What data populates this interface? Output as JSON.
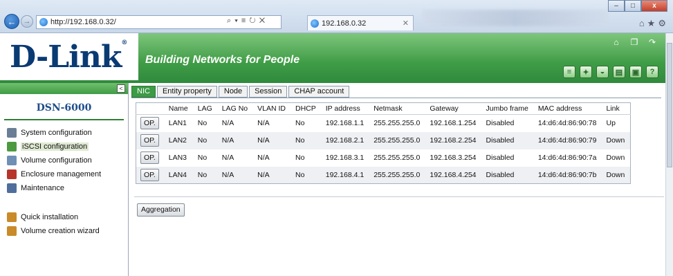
{
  "browser": {
    "url": "http://192.168.0.32/",
    "address_tools": "⌕ ▾ ≡ ↻ ✕",
    "tab_title": "192.168.0.32",
    "tab_close": "✕",
    "back_glyph": "←",
    "forward_glyph": "→",
    "minimize": "–",
    "maximize": "□",
    "close": "x",
    "fav_icons": "⌂★⚙"
  },
  "header": {
    "logo": "D-Link",
    "logo_reg": "®",
    "tagline": "Building Networks for People",
    "top_icons": [
      {
        "name": "home-icon",
        "glyph": "⌂"
      },
      {
        "name": "reboot-icon",
        "glyph": "❐"
      },
      {
        "name": "logout-icon",
        "glyph": "↷"
      }
    ],
    "tool_icons": [
      {
        "name": "disk-icon",
        "glyph": "≡"
      },
      {
        "name": "wizard-icon",
        "glyph": "✦"
      },
      {
        "name": "network-icon",
        "glyph": "◒"
      },
      {
        "name": "save-icon",
        "glyph": "▤"
      },
      {
        "name": "monitor-icon",
        "glyph": "▣"
      },
      {
        "name": "help-icon",
        "glyph": "?"
      }
    ]
  },
  "sidebar": {
    "collapse_glyph": "<",
    "device_name": "DSN-6000",
    "menu": [
      {
        "label": "System configuration",
        "icon": "system-config-icon",
        "color": "#6a7f95"
      },
      {
        "label": "iSCSI configuration",
        "icon": "iscsi-config-icon",
        "color": "#4c9a3f",
        "selected": true
      },
      {
        "label": "Volume configuration",
        "icon": "volume-config-icon",
        "color": "#6f8fb5"
      },
      {
        "label": "Enclosure management",
        "icon": "enclosure-icon",
        "color": "#b8342a"
      },
      {
        "label": "Maintenance",
        "icon": "maintenance-icon",
        "color": "#4f6e9c"
      }
    ],
    "menu2": [
      {
        "label": "Quick installation",
        "icon": "quick-install-icon",
        "color": "#c98a2a"
      },
      {
        "label": "Volume creation wizard",
        "icon": "volume-wizard-icon",
        "color": "#c98a2a"
      }
    ]
  },
  "tabs": [
    {
      "label": "NIC",
      "active": true
    },
    {
      "label": "Entity property"
    },
    {
      "label": "Node"
    },
    {
      "label": "Session"
    },
    {
      "label": "CHAP account"
    }
  ],
  "nic_table": {
    "headers": [
      "",
      "Name",
      "LAG",
      "LAG No",
      "VLAN ID",
      "DHCP",
      "IP address",
      "Netmask",
      "Gateway",
      "Jumbo frame",
      "MAC address",
      "Link"
    ],
    "rows": [
      [
        "OP.",
        "LAN1",
        "No",
        "N/A",
        "N/A",
        "No",
        "192.168.1.1",
        "255.255.255.0",
        "192.168.1.254",
        "Disabled",
        "14:d6:4d:86:90:78",
        "Up"
      ],
      [
        "OP.",
        "LAN2",
        "No",
        "N/A",
        "N/A",
        "No",
        "192.168.2.1",
        "255.255.255.0",
        "192.168.2.254",
        "Disabled",
        "14:d6:4d:86:90:79",
        "Down"
      ],
      [
        "OP.",
        "LAN3",
        "No",
        "N/A",
        "N/A",
        "No",
        "192.168.3.1",
        "255.255.255.0",
        "192.168.3.254",
        "Disabled",
        "14:d6:4d:86:90:7a",
        "Down"
      ],
      [
        "OP.",
        "LAN4",
        "No",
        "N/A",
        "N/A",
        "No",
        "192.168.4.1",
        "255.255.255.0",
        "192.168.4.254",
        "Disabled",
        "14:d6:4d:86:90:7b",
        "Down"
      ]
    ]
  },
  "aggregation_label": "Aggregation"
}
